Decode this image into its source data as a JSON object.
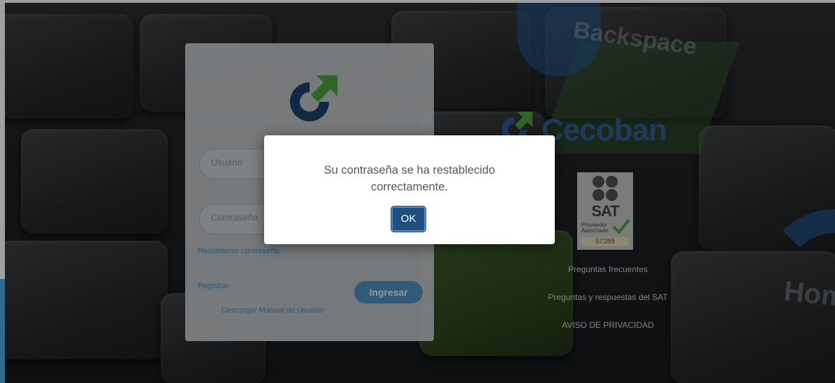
{
  "login": {
    "username_placeholder": "Usuario",
    "password_placeholder": "Contraseña",
    "reset_password_link": "Restablecer contraseña",
    "register_link": "Registrar",
    "submit_label": "Ingresar",
    "manual_link": "Descargar Manual de Usuario"
  },
  "brand": {
    "name": "Cecoban",
    "sat_seal": {
      "title": "SAT",
      "subtitle_line1": "Proveedor",
      "subtitle_line2": "Autorizado",
      "number": "57289"
    },
    "links": [
      "Preguntas frecuentes",
      "Preguntas y respuestas del SAT",
      "AVISO DE PRIVACIDAD"
    ]
  },
  "background": {
    "key_labels": [
      "Backspace",
      "Hom"
    ]
  },
  "dialog": {
    "message": "Su contraseña se ha restablecido correctamente.",
    "ok_label": "OK"
  },
  "colors": {
    "brand_blue": "#2d5b8f",
    "brand_green": "#4c9a3f",
    "link_blue": "#3e88c2",
    "button_blue": "#1f4f80"
  }
}
